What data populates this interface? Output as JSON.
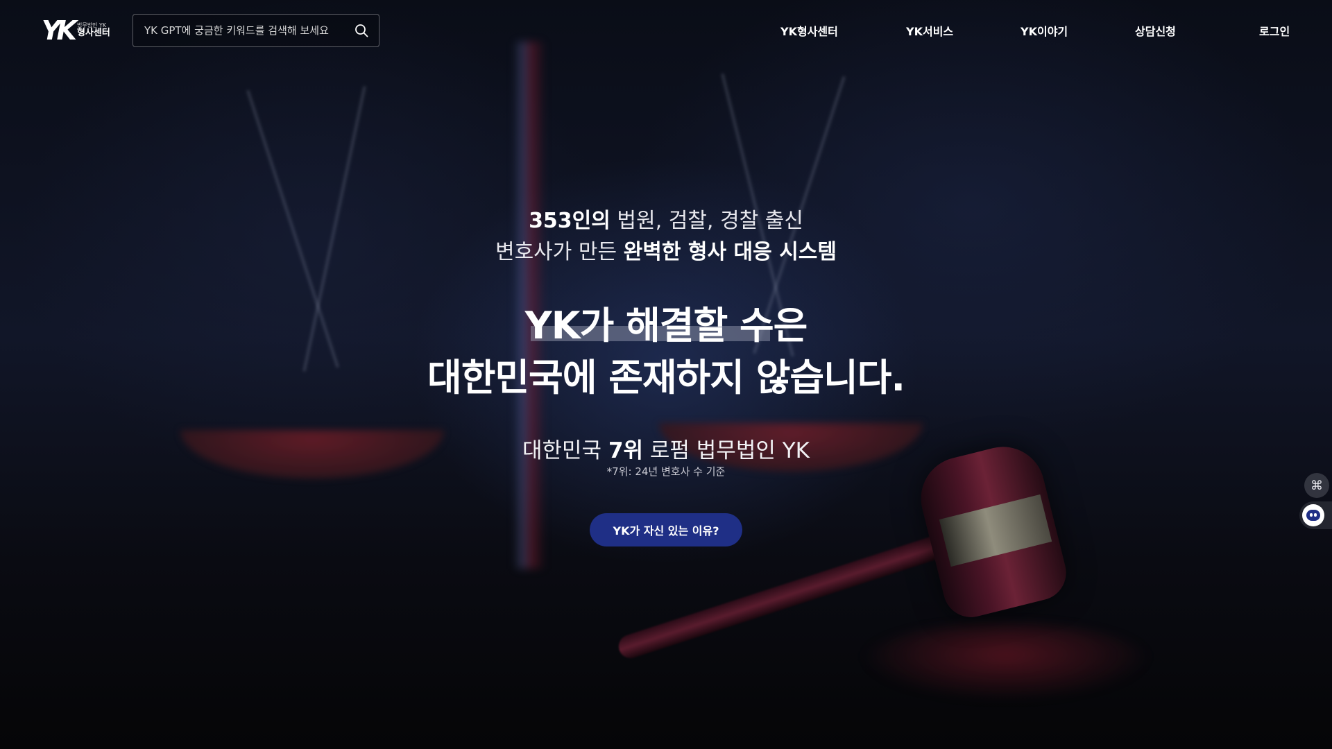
{
  "header": {
    "logo_mark": "YK",
    "logo_sub": "법무법인 YK",
    "logo_main": "형사센터",
    "search": {
      "placeholder": "YK GPT에 궁금한 키워드를 검색해 보세요",
      "icon": "search-icon"
    },
    "nav": [
      {
        "label": "YK형사센터"
      },
      {
        "label": "YK서비스"
      },
      {
        "label": "YK이야기"
      },
      {
        "label": "상담신청"
      },
      {
        "label": "로그인"
      }
    ]
  },
  "hero": {
    "intro_line1_bold": "353인의",
    "intro_line1_rest": " 법원, 검찰, 경찰 출신",
    "intro_line2_rest": "변호사가 만든 ",
    "intro_line2_bold": "완벽한 형사 대응 시스템",
    "headline_line1": "YK가 해결할 수은",
    "headline_line2": "대한민국에 존재하지 않습니다.",
    "rank_prefix": "대한민국 ",
    "rank_bold": "7위",
    "rank_suffix": " 로펌 법무법인 YK",
    "rank_note": "*7위: 24년 변호사 수 기준",
    "cta_label": "YK가 자신 있는 이유?"
  },
  "widgets": {
    "command_icon": "⌘",
    "chat_icon": "chatbot-icon"
  },
  "colors": {
    "accent": "#1f2f86",
    "background": "#0a0d17"
  }
}
